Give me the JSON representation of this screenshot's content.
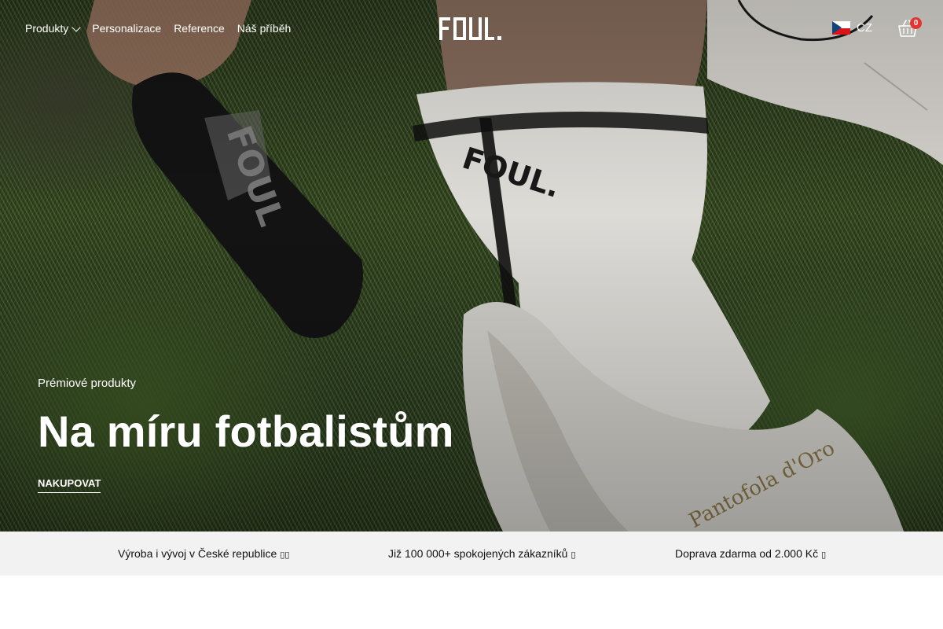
{
  "header": {
    "nav": [
      {
        "label": "Produkty",
        "has_dropdown": true
      },
      {
        "label": "Personalizace"
      },
      {
        "label": "Reference"
      },
      {
        "label": "Náš příběh"
      }
    ],
    "logo_text": "FOUL.",
    "language": {
      "code": "CZ",
      "flag_icon": "czech-flag-icon"
    },
    "cart": {
      "icon": "basket-icon",
      "count": "0"
    }
  },
  "hero": {
    "eyebrow": "Prémiové produkty",
    "headline": "Na míru fotbalistům",
    "cta_label": "NAKUPOVAT"
  },
  "usps": [
    {
      "text": "Výroba i vývoj v České republice",
      "icon": "flag-emoji-icon"
    },
    {
      "text": "Již 100 000+ spokojených zákazníků",
      "icon": "emoji-icon"
    },
    {
      "text": "Doprava zdarma od 2.000 Kč",
      "icon": "emoji-icon"
    }
  ],
  "colors": {
    "cart_badge": "#e3342f",
    "usp_bar_bg": "#f2f2f2",
    "header_text": "#ffffff"
  }
}
